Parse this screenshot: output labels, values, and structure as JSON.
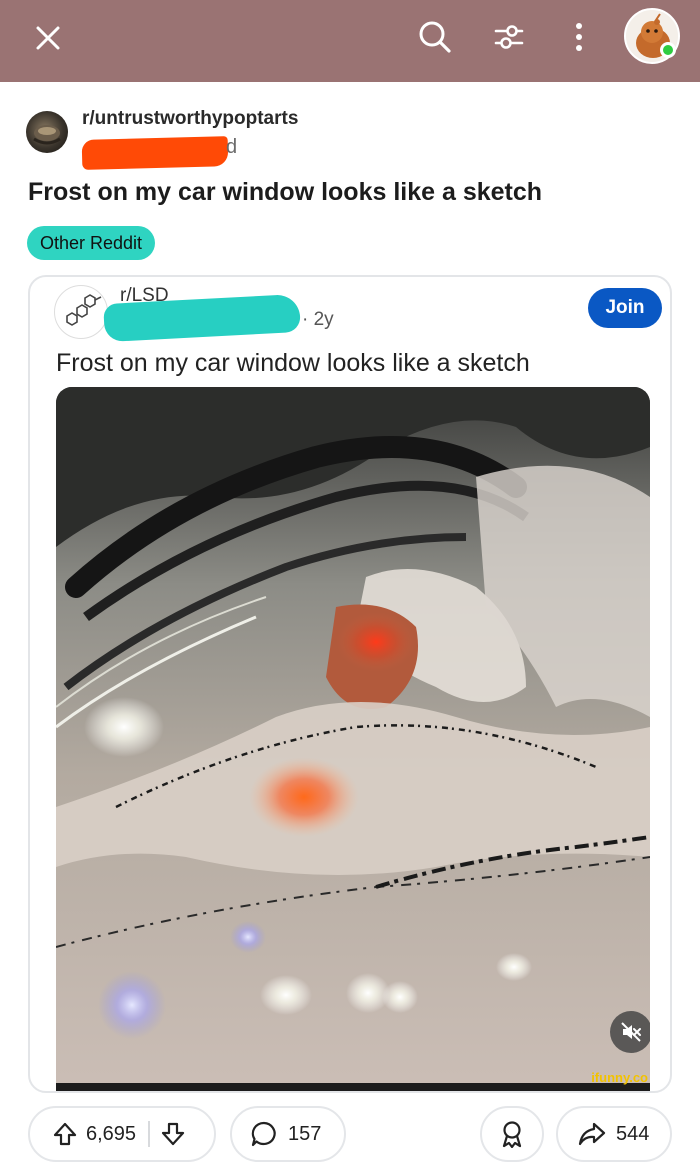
{
  "topbar": {
    "close_icon": "close-icon",
    "search_icon": "search-icon",
    "filter_icon": "filter-icon",
    "more_icon": "more-vertical-icon",
    "avatar": "user-avatar",
    "status": "online",
    "bg_color": "#9a7373"
  },
  "post": {
    "subreddit": "r/untrustworthypoptarts",
    "meta_tail": "d",
    "title": "Frost on my car window looks like a sketch",
    "flair": "Other Reddit",
    "flair_color": "#2fd4c1"
  },
  "crosspost": {
    "subreddit": "r/LSD",
    "meta": "· 2y",
    "join_label": "Join",
    "title": "Frost on my car window looks like a sketch",
    "watermark": "ifunny.co",
    "join_color": "#0a58c4"
  },
  "actions": {
    "upvotes": "6,695",
    "comments": "157",
    "shares": "544"
  }
}
